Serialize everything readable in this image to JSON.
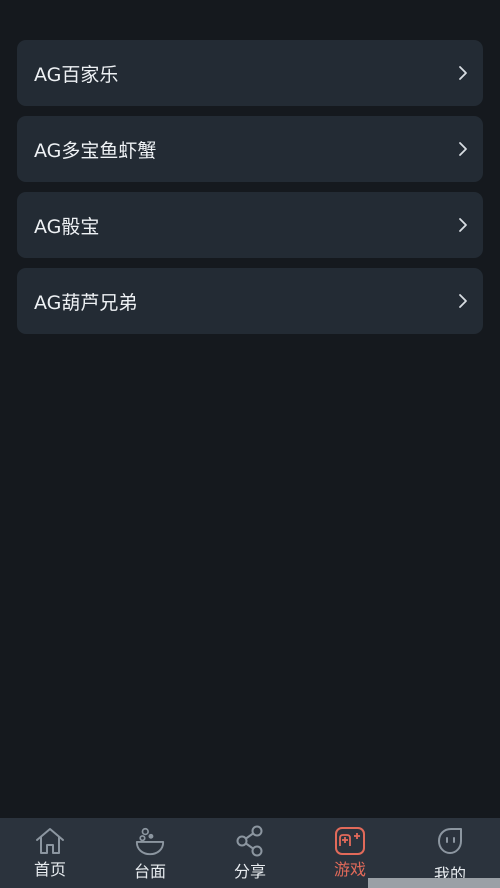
{
  "games": [
    {
      "label": "AG百家乐"
    },
    {
      "label": "AG多宝鱼虾蟹"
    },
    {
      "label": "AG骰宝"
    },
    {
      "label": "AG葫芦兄弟"
    }
  ],
  "tabbar": {
    "active": "games",
    "items": [
      {
        "key": "home",
        "label": "首页",
        "icon": "home-icon"
      },
      {
        "key": "table",
        "label": "台面",
        "icon": "bowl-icon"
      },
      {
        "key": "share",
        "label": "分享",
        "icon": "share-icon"
      },
      {
        "key": "games",
        "label": "游戏",
        "icon": "gamepad-icon"
      },
      {
        "key": "mine",
        "label": "我的",
        "icon": "face-icon"
      }
    ]
  },
  "colors": {
    "background": "#15191e",
    "card": "#232b34",
    "tabbar": "#2b333d",
    "accent": "#e26a5a",
    "icon": "#8c96a0"
  }
}
